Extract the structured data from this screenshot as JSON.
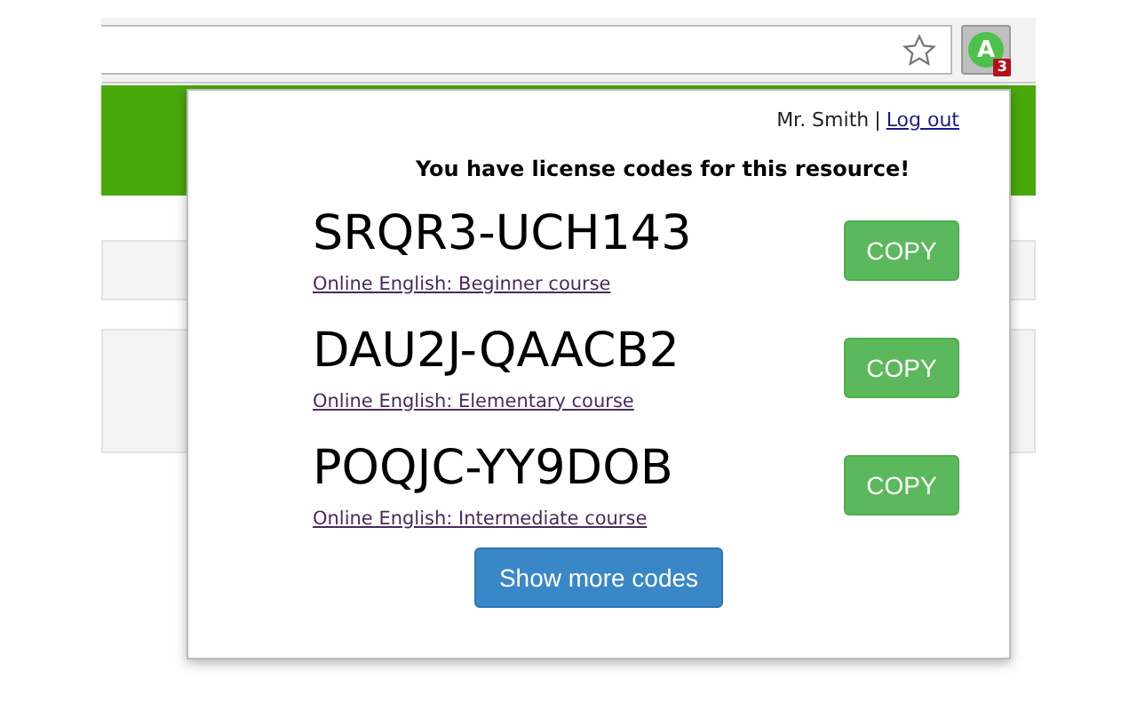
{
  "toolbar": {
    "extension_letter": "A",
    "badge": "3"
  },
  "popup": {
    "user": "Mr. Smith",
    "separator": "|",
    "logout": "Log out",
    "heading": "You have license codes for this resource!",
    "codes": [
      {
        "code": "SRQR3-UCH143",
        "course": "Online English: Beginner course",
        "button": "COPY"
      },
      {
        "code": "DAU2J-QAACB2",
        "course": "Online English: Elementary course",
        "button": "COPY"
      },
      {
        "code": "POQJC-YY9DOB",
        "course": "Online English: Intermediate course",
        "button": "COPY"
      }
    ],
    "more_button": "Show more codes"
  }
}
